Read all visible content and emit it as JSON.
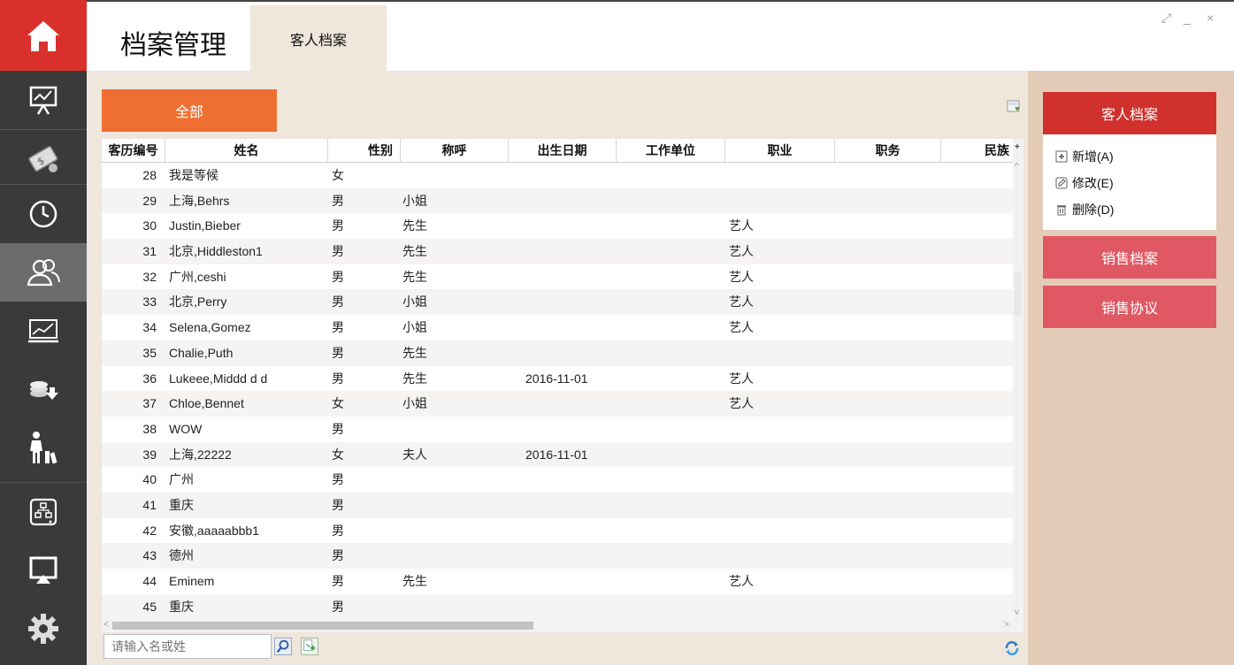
{
  "header": {
    "title": "档案管理",
    "tab": "客人档案",
    "window_controls": [
      "⤢",
      "_",
      "×"
    ]
  },
  "sidebar": {
    "items": [
      {
        "icon": "home-icon"
      },
      {
        "icon": "presentation-chart-icon"
      },
      {
        "icon": "money-icon"
      },
      {
        "icon": "clock-icon"
      },
      {
        "icon": "users-icon",
        "active": true
      },
      {
        "icon": "line-chart-icon"
      },
      {
        "icon": "coins-down-icon"
      },
      {
        "icon": "person-luggage-icon"
      },
      {
        "icon": "hierarchy-icon"
      },
      {
        "icon": "screen-share-icon"
      },
      {
        "icon": "gear-icon"
      }
    ],
    "accent": "#d9302c"
  },
  "main": {
    "filter_button": "全部",
    "columns": [
      "客历编号",
      "姓名",
      "性别",
      "称呼",
      "出生日期",
      "工作单位",
      "职业",
      "职务",
      "民族"
    ],
    "rows": [
      [
        "28",
        "我是等候",
        "女",
        "",
        "",
        "",
        "",
        "",
        ""
      ],
      [
        "29",
        "上海,Behrs",
        "男",
        "小姐",
        "",
        "",
        "",
        "",
        ""
      ],
      [
        "30",
        "Justin,Bieber",
        "男",
        "先生",
        "",
        "",
        "艺人",
        "",
        ""
      ],
      [
        "31",
        "北京,Hiddleston1",
        "男",
        "先生",
        "",
        "",
        "艺人",
        "",
        ""
      ],
      [
        "32",
        "广州,ceshi",
        "男",
        "先生",
        "",
        "",
        "艺人",
        "",
        ""
      ],
      [
        "33",
        "北京,Perry",
        "男",
        "小姐",
        "",
        "",
        "艺人",
        "",
        ""
      ],
      [
        "34",
        "Selena,Gomez",
        "男",
        "小姐",
        "",
        "",
        "艺人",
        "",
        ""
      ],
      [
        "35",
        "Chalie,Puth",
        "男",
        "先生",
        "",
        "",
        "",
        "",
        ""
      ],
      [
        "36",
        "Lukeee,Middd d d",
        "男",
        "先生",
        "2016-11-01",
        "",
        "艺人",
        "",
        ""
      ],
      [
        "37",
        "Chloe,Bennet",
        "女",
        "小姐",
        "",
        "",
        "艺人",
        "",
        ""
      ],
      [
        "38",
        "WOW",
        "男",
        "",
        "",
        "",
        "",
        "",
        ""
      ],
      [
        "39",
        "上海,22222",
        "女",
        "夫人",
        "2016-11-01",
        "",
        "",
        "",
        ""
      ],
      [
        "40",
        "广州",
        "男",
        "",
        "",
        "",
        "",
        "",
        ""
      ],
      [
        "41",
        "重庆",
        "男",
        "",
        "",
        "",
        "",
        "",
        ""
      ],
      [
        "42",
        "安徽,aaaaabbb1",
        "男",
        "",
        "",
        "",
        "",
        "",
        ""
      ],
      [
        "43",
        "德州",
        "男",
        "",
        "",
        "",
        "",
        "",
        ""
      ],
      [
        "44",
        "Eminem",
        "男",
        "先生",
        "",
        "",
        "艺人",
        "",
        ""
      ],
      [
        "45",
        "重庆",
        "男",
        "",
        "",
        "",
        "",
        "",
        ""
      ]
    ],
    "search": {
      "placeholder": "请输入名或姓"
    }
  },
  "right_panel": {
    "title": "客人档案",
    "actions": [
      {
        "label": "新增(A)",
        "icon": "plus-box-icon"
      },
      {
        "label": "修改(E)",
        "icon": "edit-icon"
      },
      {
        "label": "删除(D)",
        "icon": "trash-icon"
      }
    ],
    "buttons": [
      "销售档案",
      "销售协议"
    ]
  },
  "colors": {
    "orange": "#ef6f33",
    "red": "#d0312d",
    "pink": "#e05863",
    "panel_bg": "#e3cbb7",
    "main_bg": "#efe6dc"
  }
}
